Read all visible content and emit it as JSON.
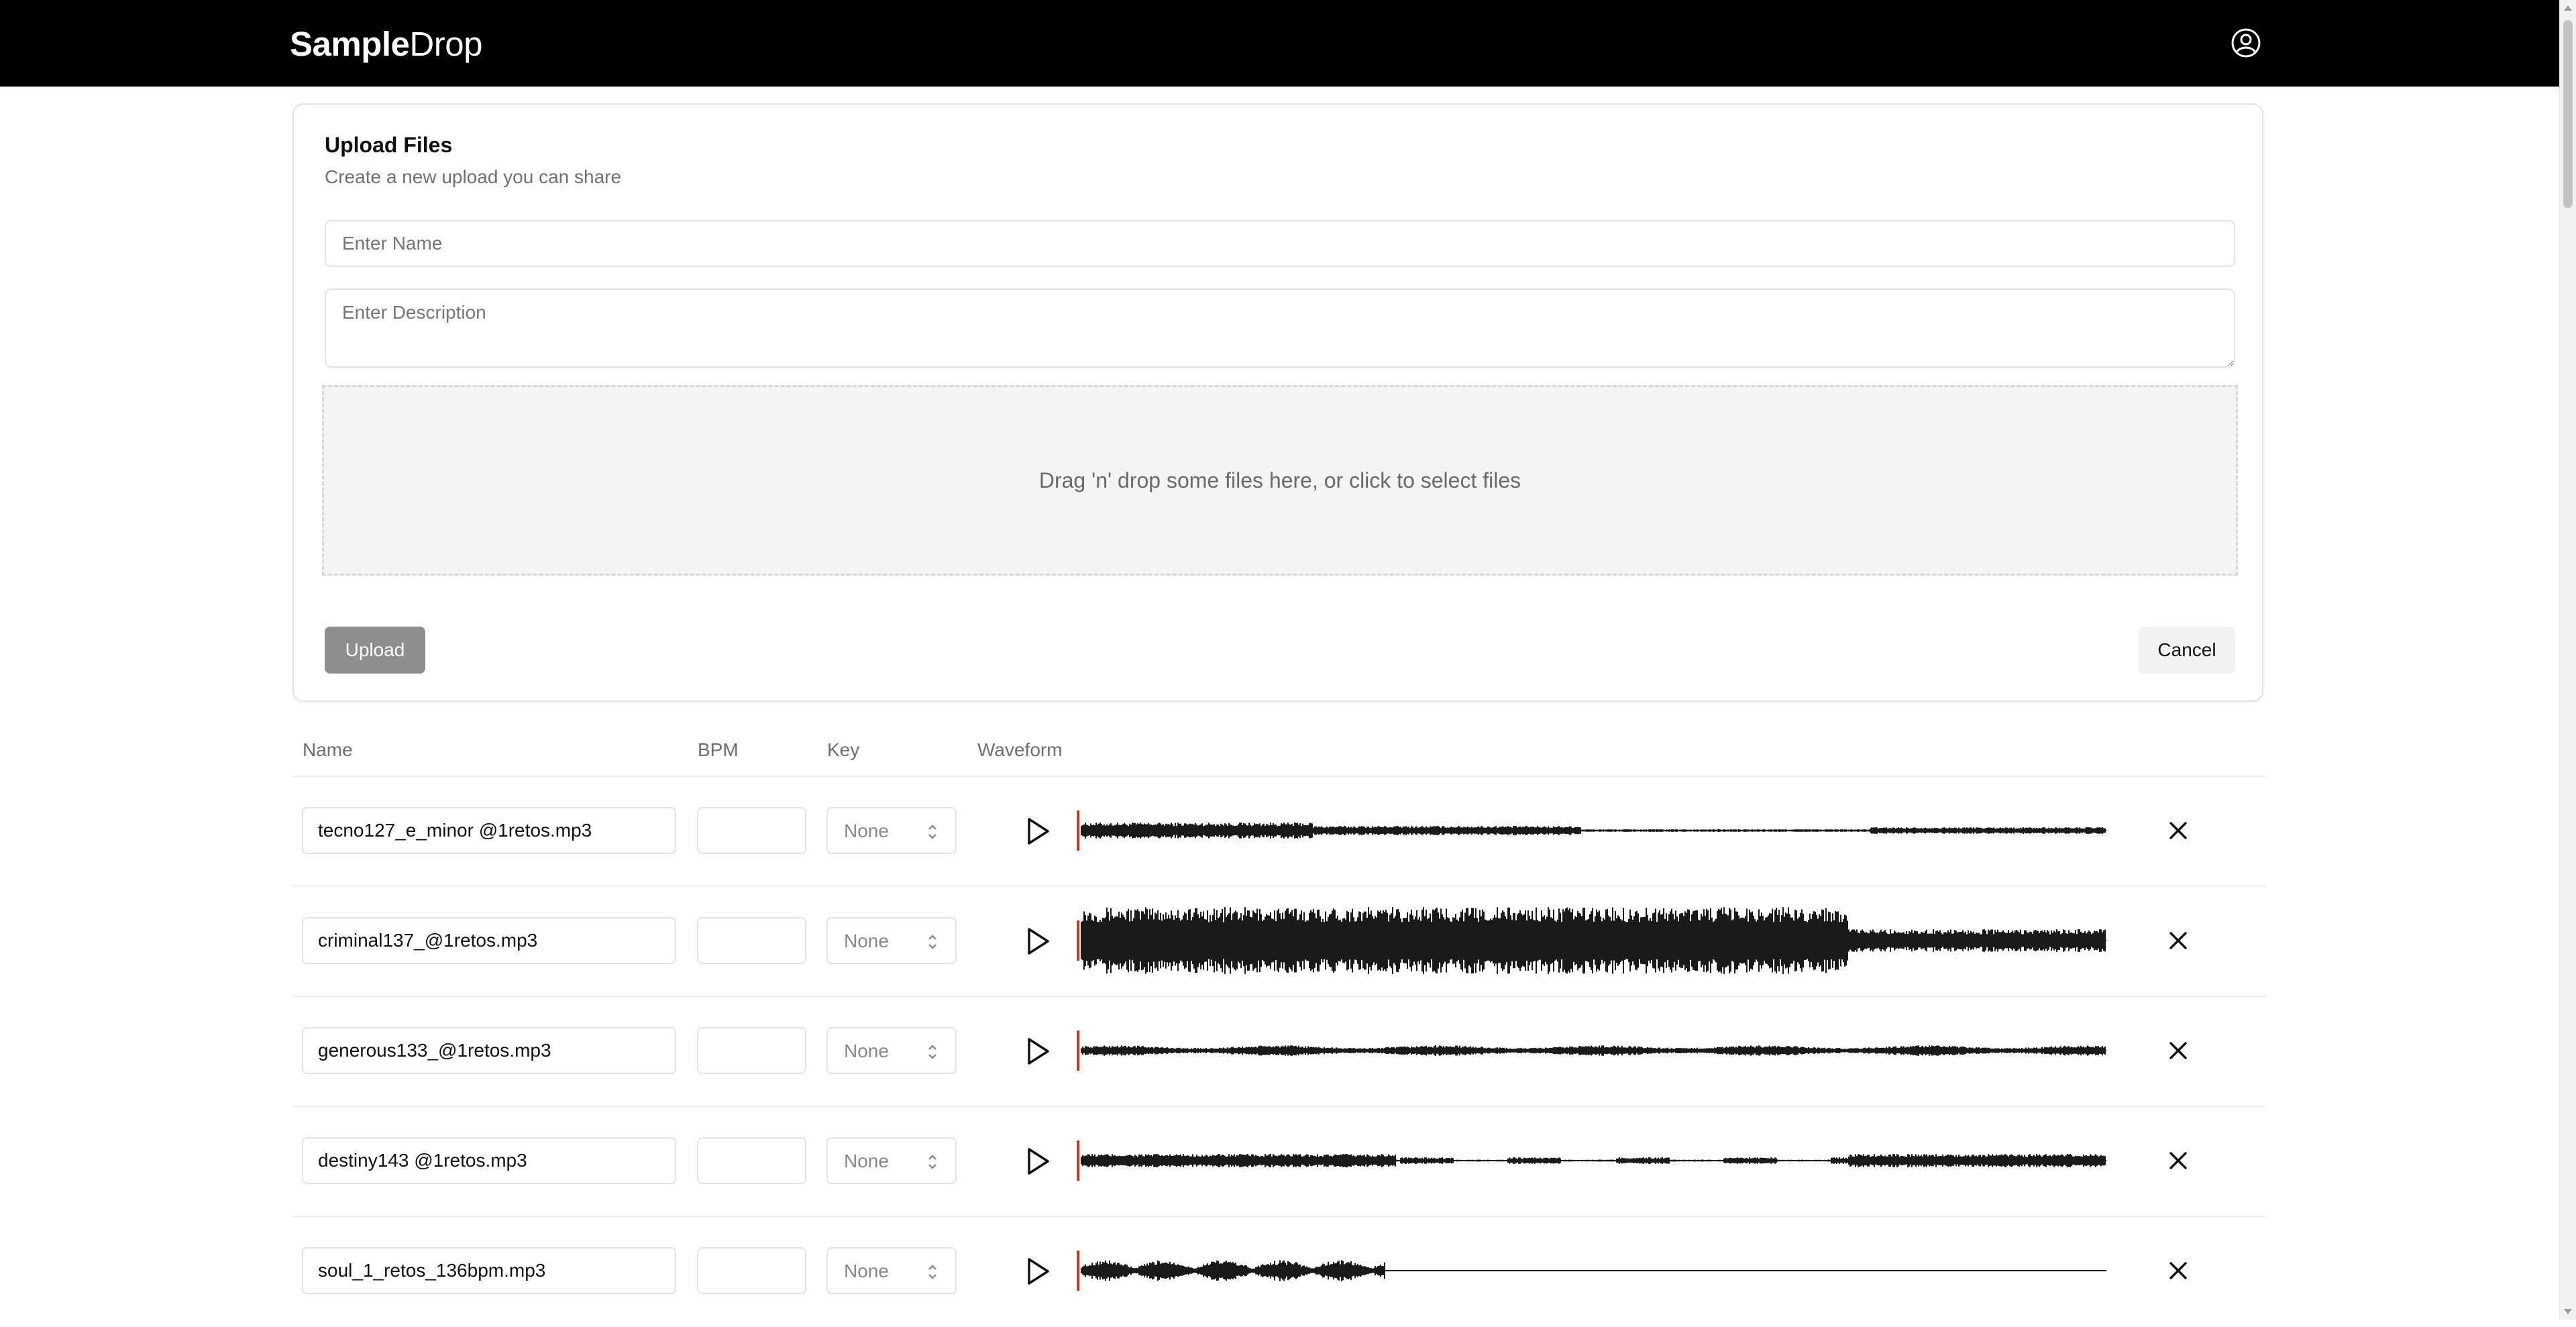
{
  "app": {
    "logo_bold": "Sample",
    "logo_light": "Drop",
    "profile_icon": "user-circle-icon"
  },
  "upload": {
    "title": "Upload Files",
    "subtitle": "Create a new upload you can share",
    "name_placeholder": "Enter Name",
    "name_value": "",
    "description_placeholder": "Enter Description",
    "description_value": "",
    "dropzone_text": "Drag 'n' drop some files here, or click to select files",
    "upload_label": "Upload",
    "cancel_label": "Cancel"
  },
  "table": {
    "headers": {
      "name": "Name",
      "bpm": "BPM",
      "key": "Key",
      "waveform": "Waveform"
    },
    "rows": [
      {
        "filename": "tecno127_e_minor @1retos.mp3",
        "bpm": "",
        "key": "None"
      },
      {
        "filename": "criminal137_@1retos.mp3",
        "bpm": "",
        "key": "None"
      },
      {
        "filename": "generous133_@1retos.mp3",
        "bpm": "",
        "key": "None"
      },
      {
        "filename": "destiny143 @1retos.mp3",
        "bpm": "",
        "key": "None"
      },
      {
        "filename": "soul_1_retos_136bpm.mp3",
        "bpm": "",
        "key": "None"
      }
    ]
  },
  "colors": {
    "header_bg": "#000000",
    "upload_disabled": "#8e8e8e",
    "playhead": "#c0392b",
    "waveform": "#1a1a1a"
  }
}
